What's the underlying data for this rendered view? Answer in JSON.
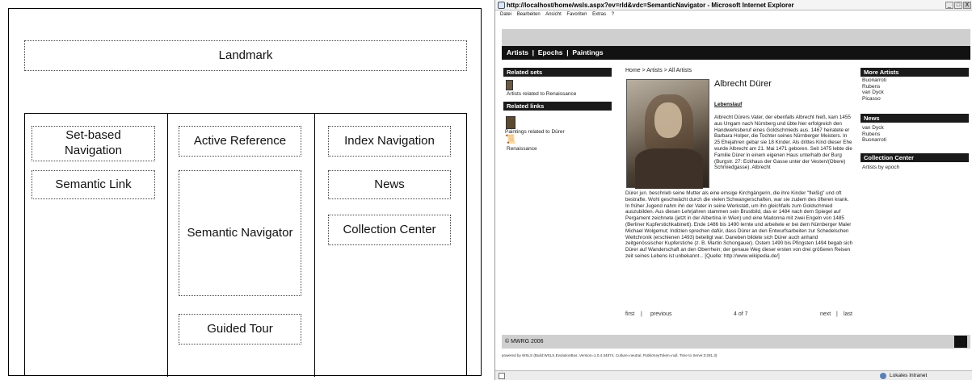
{
  "diagram": {
    "landmark": "Landmark",
    "col1": {
      "set_based": "Set-based Navigation",
      "semantic_link": "Semantic Link"
    },
    "col2": {
      "active_reference": "Active Reference",
      "semantic_navigator": "Semantic Navigator",
      "guided_tour": "Guided Tour"
    },
    "col3": {
      "index_navigation": "Index Navigation",
      "news": "News",
      "collection_center": "Collection Center"
    }
  },
  "browser": {
    "title": "http://localhost/home/wsls.aspx?ev=rld&vdc=SemanticNavigator - Microsoft Internet Explorer",
    "window_buttons": {
      "minimize": "_",
      "maximize": "□",
      "close": "X"
    },
    "menu": [
      "Datei",
      "Bearbeiten",
      "Ansicht",
      "Favoriten",
      "Extras",
      "?"
    ],
    "status": {
      "right_label": "Lokales Intranet"
    }
  },
  "page": {
    "nav": {
      "artists": "Artists",
      "epochs": "Epochs",
      "paintings": "Paintings",
      "sep": "|"
    },
    "left": {
      "related_sets_title": "Related sets",
      "related_sets_item": "Artists related to Renaissance",
      "related_links_title": "Related links",
      "related_link_1": "Paintings related to Dürer",
      "related_link_2": "Renaissance"
    },
    "breadcrumb": "Home > Artists > All Artists",
    "artist_name": "Albrecht Dürer",
    "section_label": "Lebenslauf",
    "bio_right": "Albrecht Dürers Vater, der ebenfalls Albrecht hieß, kam 1455 aus Ungarn nach Nürnberg und übte hier erfolgreich den Handwerksberuf eines Goldschmieds aus. 1467 heiratete er Barbara Holper, die Tochter seines Nürnberger Meisters. In 25 Ehejahren gebar sie 18 Kinder. Als drittes Kind dieser Ehe wurde Albrecht am 21. Mai 1471 geboren. Seit 1475 lebte die Familie Dürer in einem eigenen Haus unterhalb der Burg (Burgstr. 27: Eckhaus der Gasse unter der Vesten/(Obere) Schmiedgasse). Albrecht",
    "bio_full": "Dürer jun. beschrieb seine Mutter als eine emsige Kirchgängerin, die ihre Kinder \"fleißig\" und oft bestrafte. Wohl geschwächt durch die vielen Schwangerschaften, war sie zudem des öfteren krank. In früher Jugend nahm ihn der Vater in seine Werkstatt, um ihn gleichfalls zum Goldschmied auszubilden. Aus diesen Lehrjahren stammen sein Brustbild, das er 1484 nach dem Spiegel auf Pergament zeichnete (jetzt in der Albertina in Wien) und eine Madonna mit zwei Engeln von 1485 (Berliner Kupferstichkabinett). Ende 1486 bis 1490 lernte und arbeitete er bei dem Nürnberger Maler Michael Wolgemut; Indizien sprechen dafür, dass Dürer an den Entwurfsarbeiten zur Schedelschen Weltchronik (erschienen 1493) beteiligt war. Daneben bildete sich Dürer auch anhand zeitgenössischer Kupferstiche (z. B. Martin Schongauer). Ostern 1490 bis Pfingsten 1494 begab sich Dürer auf Wanderschaft an den Oberrhein; der genaue Weg dieser ersten von drei größeren Reisen zeit seines Lebens ist unbekannt... [Quelle: http://www.wikipedia.de/]",
    "pager": {
      "first": "first",
      "previous": "previous",
      "sep": "|",
      "position": "4 of 7",
      "next": "next",
      "last": "last"
    },
    "right": {
      "more_artists_title": "More Artists",
      "more_artists": [
        "Buonarroti",
        "Rubens",
        "van Dyck",
        "Picasso"
      ],
      "news_title": "News",
      "news_items": [
        "van Dyck",
        "Rubens",
        "Buonarroti"
      ],
      "collection_title": "Collection Center",
      "collection_item": "Artists by epoch"
    },
    "footer": "© MWRG 2006",
    "powered_by": "powered by WSLS (Build:WSLS.EvolutionBus, Version=1.0.4.34874, Culture=neutral, PublicKeyToken=null, Time to Serve:3:281.3)"
  }
}
